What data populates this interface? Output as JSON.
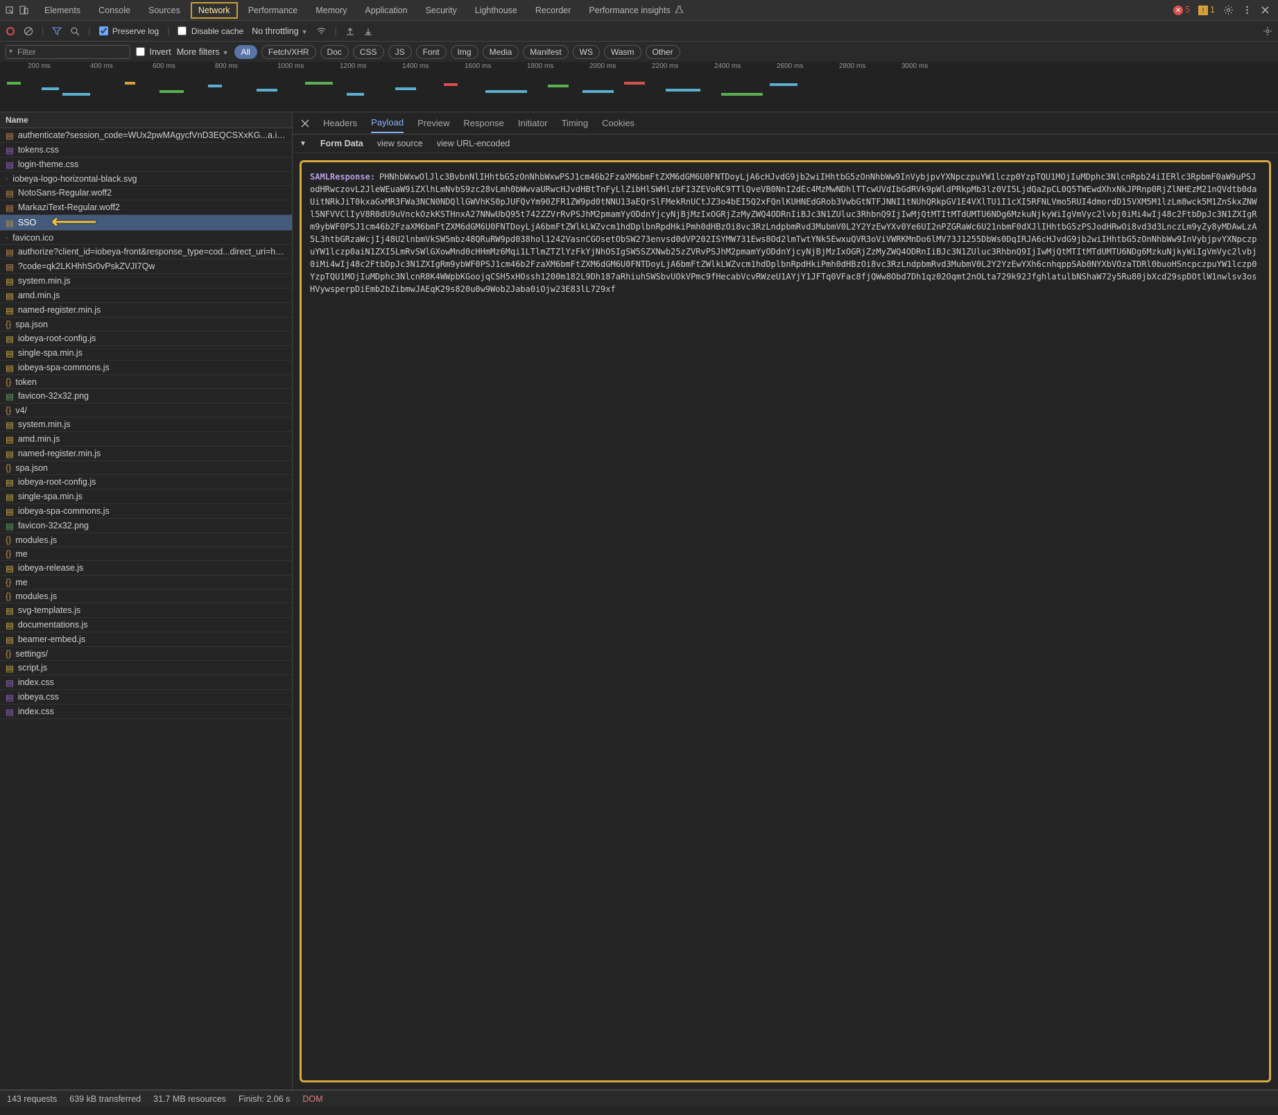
{
  "titlebar": {
    "tabs": [
      "Elements",
      "Console",
      "Sources",
      "Network",
      "Performance",
      "Memory",
      "Application",
      "Security",
      "Lighthouse",
      "Recorder",
      "Performance insights"
    ],
    "active_tab": "Network",
    "error_count": 5,
    "warn_count": 1
  },
  "toolbar2": {
    "preserve_log": "Preserve log",
    "disable_cache": "Disable cache",
    "throttling": "No throttling"
  },
  "toolbar3": {
    "filter_placeholder": "Filter",
    "invert": "Invert",
    "more_filters": "More filters",
    "pills": [
      "All",
      "Fetch/XHR",
      "Doc",
      "CSS",
      "JS",
      "Font",
      "Img",
      "Media",
      "Manifest",
      "WS",
      "Wasm",
      "Other"
    ],
    "active_pill": "All"
  },
  "timeline": {
    "ticks": [
      "200 ms",
      "400 ms",
      "600 ms",
      "800 ms",
      "1000 ms",
      "1200 ms",
      "1400 ms",
      "1600 ms",
      "1800 ms",
      "2000 ms",
      "2200 ms",
      "2400 ms",
      "2600 ms",
      "2800 ms",
      "3000 ms"
    ]
  },
  "requests": {
    "header": "Name",
    "rows": [
      {
        "name": "authenticate?session_code=WUx2pwMAgycfVnD3EQCSXxKG...a.iobeya.co...",
        "type": "doc",
        "selected": false
      },
      {
        "name": "tokens.css",
        "type": "css"
      },
      {
        "name": "login-theme.css",
        "type": "css"
      },
      {
        "name": "iobeya-logo-horizontal-black.svg",
        "type": "plain"
      },
      {
        "name": "NotoSans-Regular.woff2",
        "type": "doc"
      },
      {
        "name": "MarkaziText-Regular.woff2",
        "type": "doc"
      },
      {
        "name": "SSO",
        "type": "doc",
        "selected": true,
        "arrow": true
      },
      {
        "name": "favicon.ico",
        "type": "plain"
      },
      {
        "name": "authorize?client_id=iobeya-front&response_type=cod...direct_uri=https%...",
        "type": "doc"
      },
      {
        "name": "?code=qk2LKHhhSr0vPskZVJI7Qw",
        "type": "doc"
      },
      {
        "name": "system.min.js",
        "type": "js"
      },
      {
        "name": "amd.min.js",
        "type": "js"
      },
      {
        "name": "named-register.min.js",
        "type": "js"
      },
      {
        "name": "spa.json",
        "type": "json"
      },
      {
        "name": "iobeya-root-config.js",
        "type": "js"
      },
      {
        "name": "single-spa.min.js",
        "type": "js"
      },
      {
        "name": "iobeya-spa-commons.js",
        "type": "js"
      },
      {
        "name": "token",
        "type": "json"
      },
      {
        "name": "favicon-32x32.png",
        "type": "img"
      },
      {
        "name": "v4/",
        "type": "json"
      },
      {
        "name": "system.min.js",
        "type": "js"
      },
      {
        "name": "amd.min.js",
        "type": "js"
      },
      {
        "name": "named-register.min.js",
        "type": "js"
      },
      {
        "name": "spa.json",
        "type": "json"
      },
      {
        "name": "iobeya-root-config.js",
        "type": "js"
      },
      {
        "name": "single-spa.min.js",
        "type": "js"
      },
      {
        "name": "iobeya-spa-commons.js",
        "type": "js"
      },
      {
        "name": "favicon-32x32.png",
        "type": "img"
      },
      {
        "name": "modules.js",
        "type": "json"
      },
      {
        "name": "me",
        "type": "json"
      },
      {
        "name": "iobeya-release.js",
        "type": "js"
      },
      {
        "name": "me",
        "type": "json"
      },
      {
        "name": "modules.js",
        "type": "json"
      },
      {
        "name": "svg-templates.js",
        "type": "js"
      },
      {
        "name": "documentations.js",
        "type": "js"
      },
      {
        "name": "beamer-embed.js",
        "type": "js"
      },
      {
        "name": "settings/",
        "type": "json"
      },
      {
        "name": "script.js",
        "type": "js"
      },
      {
        "name": "index.css",
        "type": "css"
      },
      {
        "name": "iobeya.css",
        "type": "css"
      },
      {
        "name": "index.css",
        "type": "css"
      }
    ]
  },
  "detail": {
    "tabs": [
      "Headers",
      "Payload",
      "Preview",
      "Response",
      "Initiator",
      "Timing",
      "Cookies"
    ],
    "active": "Payload",
    "section_label": "Form Data",
    "view_source": "view source",
    "view_urlenc": "view URL-encoded",
    "param_key": "SAMLResponse:",
    "param_value": "PHNhbWxwOlJlc3BvbnNlIHhtbG5zOnNhbWxwPSJ1cm46b2FzaXM6bmFtZXM6dGM6U0FNTDoyLjA6cHJvdG9jb2wiIHhtbG5zOnNhbWw9InVybjpvYXNpczpuYW1lczp0YzpTQU1MOjIuMDphc3NlcnRpb24iIERlc3RpbmF0aW9uPSJodHRwczovL2JleWEuaW9iZXlhLmNvbS9zc28vLmh0bWwvaURwcHJvdHBtTnFyLlZibHlSWHlzbFI3ZEVoRC9TTlQveVB0NnI2dEc4MzMwNDhlTTcwUVdIbGdRVk9pWldPRkpMb3lz0VI5LjdQa2pCL0Q5TWEwdXhxNkJPRnp0RjZlNHEzM21nQVdtb0daUitNRkJiT0kxaGxMR3FWa3NCN0NDQllGWVhKS0pJUFQvYm90ZFR1ZW9pd0tNNU13aEQrSlFMekRnUCtJZ3o4bEI5Q2xFQnlKUHNEdGRob3VwbGtNTFJNNI1tNUhQRkpGV1E4VXlTU1I1cXI5RFNLVmo5RUI4dmordD15VXM5M1lzLm8wck5M1ZnSkxZNWl5NFVVClIyV8R0dU9uVnckOzkKSTHnxA27NNwUbQ95t742ZZVrRvPSJhM2pmamYyODdnYjcyNjBjMzIxOGRjZzMyZWQ4ODRnIiBJc3N1ZUluc3RhbnQ9IjIwMjQtMTItMTdUMTU6NDg6MzkuNjkyWiIgVmVyc2lvbj0iMi4wIj48c2FtbDpJc3N1ZXIgRm9ybWF0PSJ1cm46b2FzaXM6bmFtZXM6dGM6U0FNTDoyLjA6bmFtZWlkLWZvcm1hdDplbnRpdHkiPmh0dHBzOi8vc3RzLndpbmRvd3MubmV0L2Y2YzEwYXv0Ye6UI2nPZGRaWc6U21nbmF0dXJlIHhtbG5zPSJodHRwOi8vd3d3LnczLm9yZy8yMDAwLzA5L3htbGRzaWcjIj48U2lnbmVkSW5mbz48QRuRW9pd038hol1242VasnCGOsetObSW273envsd0dVP202ISYMW731Ews8Od2lmTwtYNk5EwxuQVR3oViVWRKMnDo6lMV73J1255DbWs0DqIRJA6cHJvdG9jb2wiIHhtbG5zOnNhbWw9InVybjpvYXNpczpuYW1lczp0aiN1ZXI5LmRvSWlGXowMnd0cHHmMz6Mqi1LTlmZTZlYzFkYjNhOSIgSW5SZXNwb25zZVRvPSJhM2pmamYyODdnYjcyNjBjMzIxOGRjZzMyZWQ4ODRnIiBJc3N1ZUluc3RhbnQ9IjIwMjQtMTItMTdUMTU6NDg6MzkuNjkyWiIgVmVyc2lvbj0iMi4wIj48c2FtbDpJc3N1ZXIgRm9ybWF0PSJ1cm46b2FzaXM6bmFtZXM6dGM6U0FNTDoyLjA6bmFtZWlkLWZvcm1hdDplbnRpdHkiPmh0dHBzOi8vc3RzLndpbmRvd3MubmV0L2Y2YzEwYXh6cnhqppSAb0NYXbVOzaTDRl0buoHSncpczpuYW1lczp0YzpTQU1MOjIuMDphc3NlcnR8K4WWpbKGoojqCSH5xHOssh1200m182L9Dh187aRhiuhSWSbvUOkVPmc9fHecabVcvRWzeU1AYjY1JFTq0VFac8fjQWw8Obd7Dh1qz02Oqmt2nOLta729k92JfghlatulbNShaW72y5Ru80jbXcd29spDOtlW1nwlsv3osHVywsperpDiEmb2bZibmwJAEqK29s820u0w9Wob2Jaba0iOjw23E83lL729xf"
  },
  "status": {
    "requests": "143 requests",
    "transferred": "639 kB transferred",
    "resources": "31.7 MB resources",
    "finish": "Finish: 2.06 s",
    "dom": "DOM"
  }
}
